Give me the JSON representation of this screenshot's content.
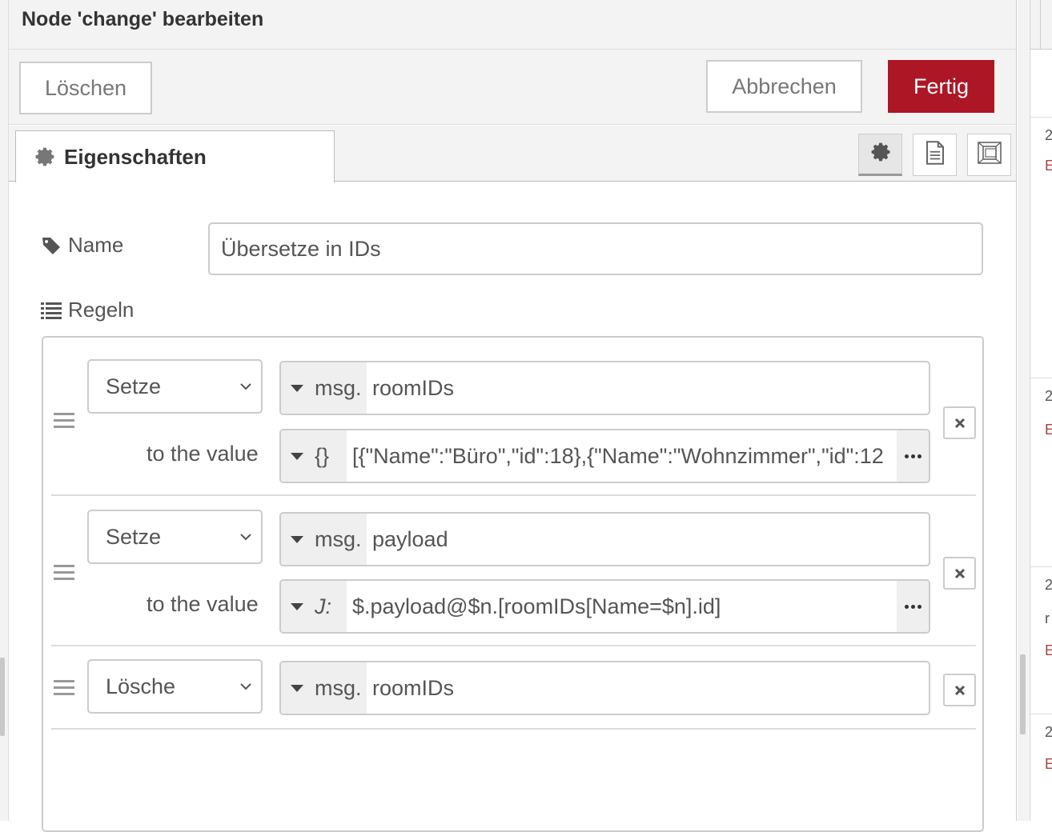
{
  "dialog": {
    "title": "Node 'change' bearbeiten"
  },
  "toolbar": {
    "delete_label": "Löschen",
    "cancel_label": "Abbrechen",
    "done_label": "Fertig"
  },
  "tabs": {
    "properties_label": "Eigenschaften",
    "icons": [
      "gear-icon",
      "document-icon",
      "frame-icon"
    ]
  },
  "form": {
    "name_label": "Name",
    "name_value": "Übersetze in IDs",
    "rules_label": "Regeln"
  },
  "rules": [
    {
      "action": "Setze",
      "target_type": "msg.",
      "target": "roomIDs",
      "to_label": "to the value",
      "value_type": "{}",
      "value": "[{\"Name\":\"Büro\",\"id\":18},{\"Name\":\"Wohnzimmer\",\"id\":12"
    },
    {
      "action": "Setze",
      "target_type": "msg.",
      "target": "payload",
      "to_label": "to the value",
      "value_type": "J:",
      "value": "$.payload@$n.[roomIDs[Name=$n].id]"
    },
    {
      "action": "Lösche",
      "target_type": "msg.",
      "target": "roomIDs"
    }
  ],
  "sidebar_peek": {
    "entries": [
      {
        "a": "2",
        "b": "E"
      },
      {
        "a": "2",
        "b": "E"
      },
      {
        "a": "2",
        "b": "r",
        "c": "E"
      },
      {
        "a": "2",
        "b": "E"
      }
    ]
  }
}
